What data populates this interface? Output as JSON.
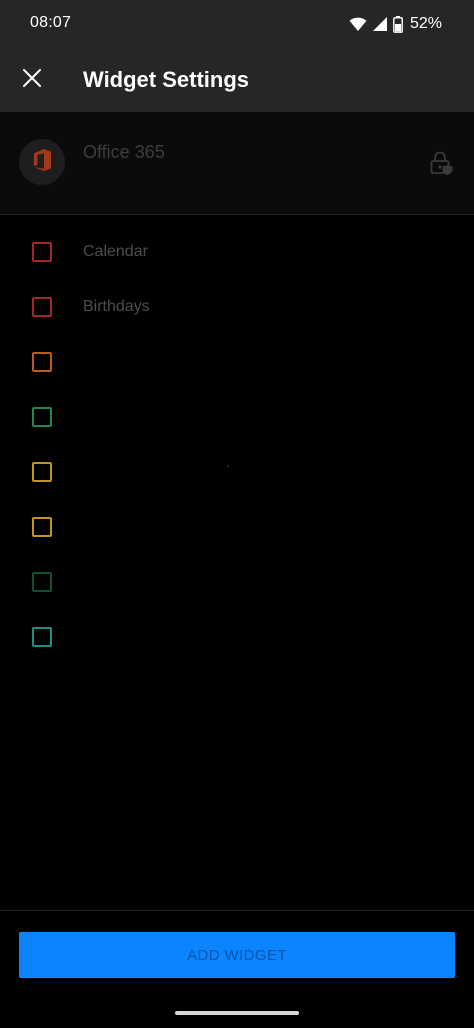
{
  "status_bar": {
    "time": "08:07",
    "battery_percent": "52%",
    "icons": [
      "wifi-icon",
      "signal-icon",
      "battery-icon"
    ]
  },
  "app_bar": {
    "title": "Widget Settings",
    "close_icon": "close-icon"
  },
  "account": {
    "name": "Office 365",
    "logo_icon": "office-logo-icon",
    "lock_icon": "lock-icon"
  },
  "calendars": [
    {
      "label": "Calendar",
      "color": "#a4262c",
      "checked": false
    },
    {
      "label": "Birthdays",
      "color": "#a4262c",
      "checked": false
    },
    {
      "label": "",
      "color": "#b85d1e",
      "checked": false
    },
    {
      "label": "",
      "color": "#1d8a4e",
      "checked": false
    },
    {
      "label": "",
      "color": "#c1951f",
      "checked": false
    },
    {
      "label": "",
      "color": "#c1951f",
      "checked": false
    },
    {
      "label": "",
      "color": "#10502b",
      "checked": false
    },
    {
      "label": "",
      "color": "#1f8f86",
      "checked": false
    }
  ],
  "footer": {
    "button_label": "ADD WIDGET",
    "button_color": "#0a84ff"
  }
}
